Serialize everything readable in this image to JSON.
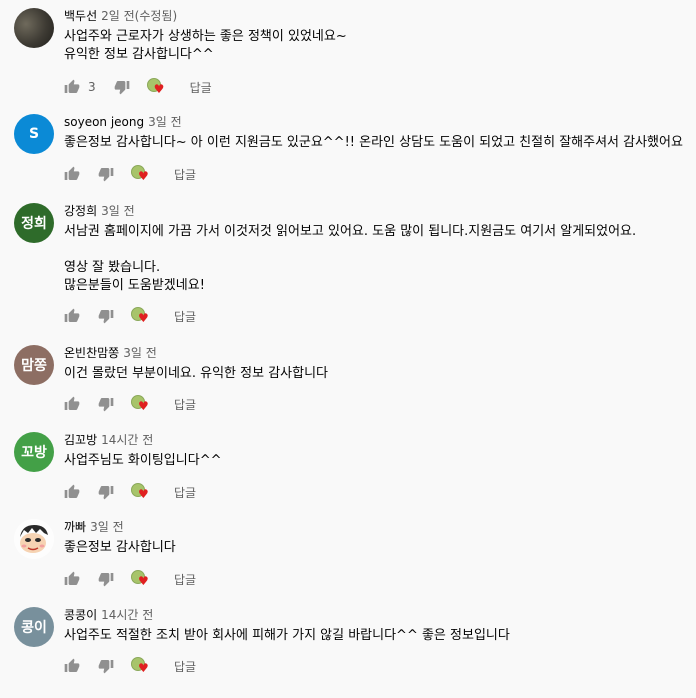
{
  "comments": [
    {
      "avatar": {
        "type": "photo",
        "color": "#3d3a33",
        "label": ""
      },
      "author": "백두선",
      "time": "2일 전(수정됨)",
      "text": "사업주와 근로자가 상생하는 좋은 정책이 있었네요~\n유익한 정보 감사합니다^^",
      "likes": "3",
      "reply": "답글"
    },
    {
      "avatar": {
        "type": "letter",
        "color": "#0b8ad6",
        "label": "S"
      },
      "author": "soyeon jeong",
      "time": "3일 전",
      "text": "좋은정보 감사합니다~ 아 이런 지원금도 있군요^^!! 온라인 상담도 도움이 되었고 친절히 잘해주셔서 감사했어요",
      "likes": "",
      "reply": "답글"
    },
    {
      "avatar": {
        "type": "letter",
        "color": "#2e6b2a",
        "label": "정희"
      },
      "author": "강정희",
      "time": "3일 전",
      "text": "서남권 홈페이지에 가끔 가서 이것저것 읽어보고 있어요. 도움 많이 됩니다.지원금도 여기서 알게되었어요.\n\n영상 잘 봤습니다.\n많은분들이 도움받겠네요!",
      "likes": "",
      "reply": "답글"
    },
    {
      "avatar": {
        "type": "letter",
        "color": "#8d6e63",
        "label": "맘쫑"
      },
      "author": "온빈찬맘쫑",
      "time": "3일 전",
      "text": "이건 몰랐던 부분이네요. 유익한 정보 감사합니다",
      "likes": "",
      "reply": "답글"
    },
    {
      "avatar": {
        "type": "letter",
        "color": "#43a047",
        "label": "꼬방"
      },
      "author": "김꼬방",
      "time": "14시간 전",
      "text": "사업주님도 화이팅입니다^^",
      "likes": "",
      "reply": "답글"
    },
    {
      "avatar": {
        "type": "cartoon",
        "color": "#ffffff",
        "label": ""
      },
      "author": "까빠",
      "time": "3일 전",
      "text": "좋은정보 감사합니다",
      "likes": "",
      "reply": "답글"
    },
    {
      "avatar": {
        "type": "letter",
        "color": "#78909c",
        "label": "콩이"
      },
      "author": "콩콩이",
      "time": "14시간 전",
      "text": "사업주도 적절한 조치 받아 회사에 피해가 가지 않길 바랍니다^^  좋은 정보입니다",
      "likes": "",
      "reply": "답글"
    }
  ],
  "icons": {
    "like": "thumbs-up-icon",
    "dislike": "thumbs-down-icon",
    "hearted": "creator-heart-icon"
  },
  "colors": {
    "heart": "#e02020",
    "meta_text": "#606060",
    "background": "#f9f9f9"
  }
}
